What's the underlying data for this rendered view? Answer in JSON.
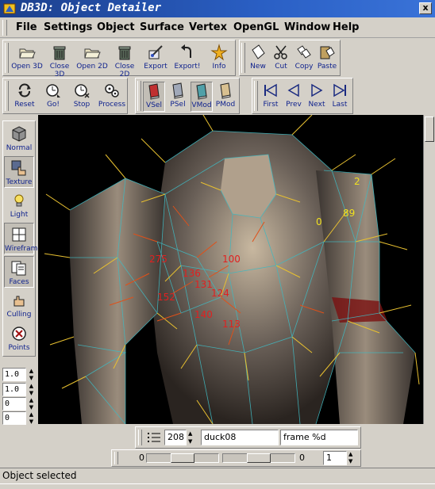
{
  "window": {
    "title": "DB3D: Object Detailer",
    "close_label": "x"
  },
  "menu": [
    "File",
    "Settings",
    "Object",
    "Surface",
    "Vertex",
    "OpenGL",
    "Window",
    "Help"
  ],
  "toolbar_file": [
    {
      "label": "Open 3D",
      "icon": "folder-open-icon"
    },
    {
      "label": "Close 3D",
      "icon": "trash-can-icon"
    },
    {
      "label": "Open 2D",
      "icon": "folder-open-icon"
    },
    {
      "label": "Close 2D",
      "icon": "trash-can-icon"
    },
    {
      "label": "Export",
      "icon": "export-brush-icon"
    },
    {
      "label": "Export!",
      "icon": "undo-arrow-icon"
    },
    {
      "label": "Info",
      "icon": "info-star-icon"
    }
  ],
  "toolbar_edit": [
    {
      "label": "New",
      "icon": "new-page-icon"
    },
    {
      "label": "Cut",
      "icon": "scissors-icon"
    },
    {
      "label": "Copy",
      "icon": "copy-pages-icon"
    },
    {
      "label": "Paste",
      "icon": "paste-clipboard-icon"
    }
  ],
  "toolbar_run": [
    {
      "label": "Reset",
      "icon": "reset-arrows-icon"
    },
    {
      "label": "Go!",
      "icon": "go-clock-icon"
    },
    {
      "label": "Stop",
      "icon": "stop-clock-icon"
    },
    {
      "label": "Process",
      "icon": "process-gears-icon"
    }
  ],
  "toolbar_select": [
    {
      "label": "VSel",
      "icon": "vertex-select-book-icon",
      "pressed": true
    },
    {
      "label": "PSel",
      "icon": "poly-select-book-icon",
      "pressed": false
    },
    {
      "label": "VMod",
      "icon": "vertex-modify-book-icon",
      "pressed": true
    },
    {
      "label": "PMod",
      "icon": "poly-modify-book-icon",
      "pressed": false
    }
  ],
  "toolbar_nav": [
    {
      "label": "First",
      "icon": "first-icon"
    },
    {
      "label": "Prev",
      "icon": "prev-icon"
    },
    {
      "label": "Next",
      "icon": "next-icon"
    },
    {
      "label": "Last",
      "icon": "last-icon"
    }
  ],
  "left_toolbar": [
    {
      "label": "Normal",
      "icon": "normal-cube-icon",
      "pressed": false
    },
    {
      "label": "Texture",
      "icon": "texture-hand-icon",
      "pressed": true
    },
    {
      "label": "Light",
      "icon": "light-bulb-icon",
      "pressed": false
    },
    {
      "label": "Wireframe",
      "icon": "wireframe-grid-icon",
      "pressed": true
    },
    {
      "label": "Faces",
      "icon": "faces-pages-icon",
      "pressed": true
    },
    {
      "label": "Culling",
      "icon": "culling-hand-icon",
      "pressed": false
    },
    {
      "label": "Points",
      "icon": "points-target-icon",
      "pressed": false
    }
  ],
  "spinners": [
    "1.0",
    "1.0",
    "0",
    "0"
  ],
  "viewport_labels": {
    "red": [
      "275",
      "100",
      "136",
      "131",
      "124",
      "152",
      "140",
      "113"
    ],
    "yellow": [
      "2",
      "89",
      "0"
    ]
  },
  "frame_bar": {
    "frame_number": "208",
    "object_name": "duck08",
    "frame_format": "frame %d"
  },
  "slider_bar": {
    "left_value": "0",
    "right_value": "0",
    "spin_value": "1"
  },
  "status_text": "Object selected"
}
